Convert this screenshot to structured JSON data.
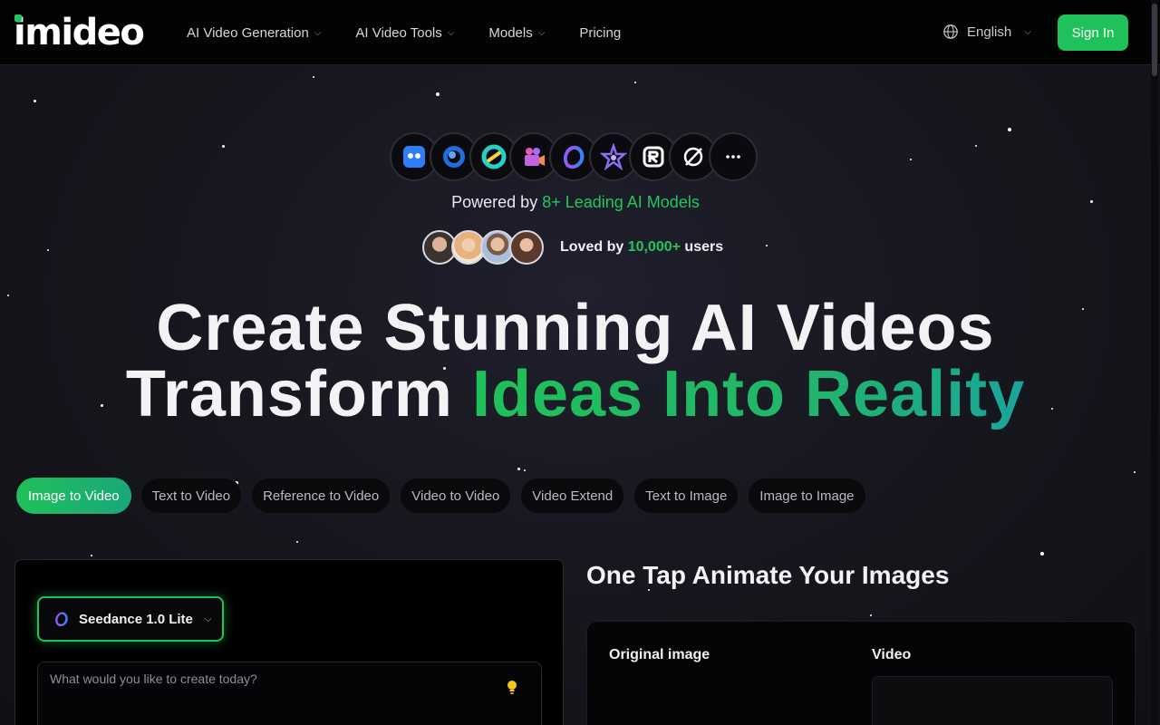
{
  "header": {
    "logo_text": "imideo",
    "nav": [
      {
        "label": "AI Video Generation",
        "has_dropdown": true
      },
      {
        "label": "AI Video Tools",
        "has_dropdown": true
      },
      {
        "label": "Models",
        "has_dropdown": true
      },
      {
        "label": "Pricing",
        "has_dropdown": false
      }
    ],
    "language": "English",
    "sign_in": "Sign In"
  },
  "hero": {
    "model_icons": [
      "pixverse-icon",
      "hailuo-icon",
      "kling-icon",
      "vidu-icon",
      "seedance-icon",
      "gemini-star-icon",
      "runway-icon",
      "sora-icon",
      "more-models-icon"
    ],
    "powered_prefix": "Powered by ",
    "powered_highlight": "8+ Leading AI Models",
    "loved_prefix": "Loved by ",
    "loved_highlight": "10,000+",
    "loved_suffix": " users",
    "title_line1": "Create Stunning AI Videos",
    "title_line2_plain": "Transform ",
    "title_line2_highlight": "Ideas Into Reality"
  },
  "tabs": [
    {
      "label": "Image to Video",
      "active": true
    },
    {
      "label": "Text to Video",
      "active": false
    },
    {
      "label": "Reference to Video",
      "active": false
    },
    {
      "label": "Video to Video",
      "active": false
    },
    {
      "label": "Video Extend",
      "active": false
    },
    {
      "label": "Text to Image",
      "active": false
    },
    {
      "label": "Image to Image",
      "active": false
    }
  ],
  "generator": {
    "model_name": "Seedance 1.0 Lite",
    "prompt_placeholder": "What would you like to create today?"
  },
  "showcase": {
    "title": "One Tap Animate Your Images",
    "original_label": "Original image",
    "video_label": "Video"
  },
  "colors": {
    "accent": "#1fc15a",
    "background": "#17171f",
    "header": "#020303"
  }
}
